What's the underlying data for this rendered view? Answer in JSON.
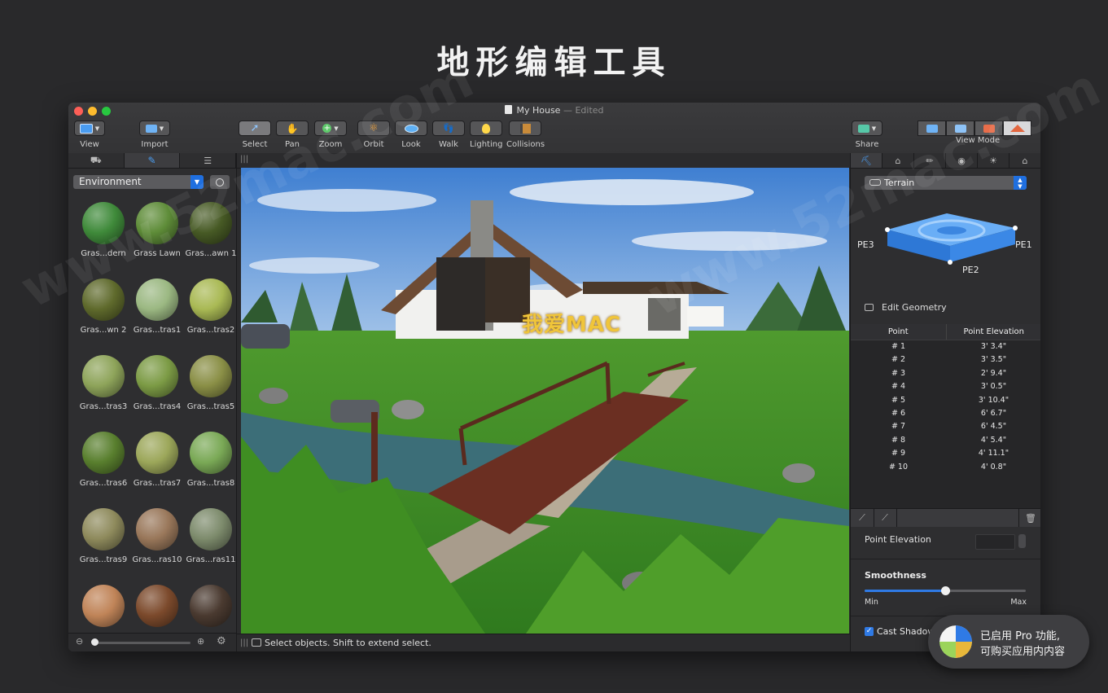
{
  "hero_title": "地形编辑工具",
  "window": {
    "title": "My House",
    "edited": "— Edited"
  },
  "toolbar": {
    "view": "View",
    "import": "Import",
    "select": "Select",
    "pan": "Pan",
    "zoom": "Zoom",
    "orbit": "Orbit",
    "look": "Look",
    "walk": "Walk",
    "lighting": "Lighting",
    "collisions": "Collisions",
    "share": "Share",
    "view_mode": "View Mode"
  },
  "left_panel": {
    "category": "Environment",
    "materials": [
      {
        "label": "Gras...dern",
        "color": "#3f8a3a"
      },
      {
        "label": "Grass Lawn",
        "color": "#5e8c38"
      },
      {
        "label": "Gras...awn 1",
        "color": "#475a25"
      },
      {
        "label": "Gras...wn 2",
        "color": "#5f6a2c"
      },
      {
        "label": "Gras...tras1",
        "color": "#9bb882"
      },
      {
        "label": "Gras...tras2",
        "color": "#a9b954"
      },
      {
        "label": "Gras...tras3",
        "color": "#8ea45a"
      },
      {
        "label": "Gras...tras4",
        "color": "#7c9b45"
      },
      {
        "label": "Gras...tras5",
        "color": "#8a8f46"
      },
      {
        "label": "Gras...tras6",
        "color": "#597f2e"
      },
      {
        "label": "Gras...tras7",
        "color": "#9ca75a"
      },
      {
        "label": "Gras...tras8",
        "color": "#7aa956"
      },
      {
        "label": "Gras...tras9",
        "color": "#8e8a5c"
      },
      {
        "label": "Gras...ras10",
        "color": "#99775a"
      },
      {
        "label": "Gras...ras11",
        "color": "#7d8b6c"
      },
      {
        "label": "",
        "color": "#c08458"
      },
      {
        "label": "",
        "color": "#7c4a2c"
      },
      {
        "label": "",
        "color": "#4a3a30"
      }
    ]
  },
  "viewport": {
    "overlay_logo": "我爱MAC"
  },
  "status": {
    "text": "Select objects. Shift to extend select."
  },
  "right_panel": {
    "object_type": "Terrain",
    "pe_labels": {
      "pe1": "PE1",
      "pe2": "PE2",
      "pe3": "PE3"
    },
    "edit_geometry": "Edit Geometry",
    "table_headers": {
      "point": "Point",
      "elevation": "Point Elevation"
    },
    "points": [
      {
        "point": "# 1",
        "elevation": "3' 3.4\""
      },
      {
        "point": "# 2",
        "elevation": "3' 3.5\""
      },
      {
        "point": "# 3",
        "elevation": "2' 9.4\""
      },
      {
        "point": "# 4",
        "elevation": "3' 0.5\""
      },
      {
        "point": "# 5",
        "elevation": "3' 10.4\""
      },
      {
        "point": "# 6",
        "elevation": "6' 6.7\""
      },
      {
        "point": "# 7",
        "elevation": "6' 4.5\""
      },
      {
        "point": "# 8",
        "elevation": "4' 5.4\""
      },
      {
        "point": "# 9",
        "elevation": "4' 11.1\""
      },
      {
        "point": "# 10",
        "elevation": "4' 0.8\""
      }
    ],
    "point_elevation_label": "Point Elevation",
    "smoothness": {
      "label": "Smoothness",
      "min": "Min",
      "max": "Max",
      "value": 0.5
    },
    "cast_shadow": "Cast Shadow",
    "cast_shadow_checked": true
  },
  "pro_badge": {
    "line1": "已启用 Pro 功能,",
    "line2": "可购买应用内内容"
  },
  "watermark_text": "www.52mac.com",
  "colors": {
    "accent": "#2f7ae5",
    "window_bg": "#2b2b2d",
    "page_bg": "#29292b"
  }
}
